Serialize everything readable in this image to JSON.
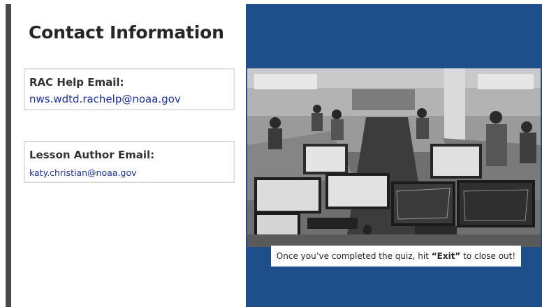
{
  "slide": {
    "title": "Contact Information"
  },
  "contacts": {
    "rac": {
      "label": "RAC Help Email:",
      "email": "nws.wdtd.rachelp@noaa.gov"
    },
    "author": {
      "label": "Lesson Author Email:",
      "email": "katy.christian@noaa.gov"
    }
  },
  "caption": {
    "before": "Once you’ve completed the quiz, hit ",
    "emphasis": "“Exit”",
    "after": " to close out!"
  },
  "colors": {
    "panel_blue": "#1f4f8a",
    "link_blue": "#1a2fa8",
    "left_bar": "#4a4a4a"
  },
  "photo": {
    "icon": "operations-room-photo"
  }
}
